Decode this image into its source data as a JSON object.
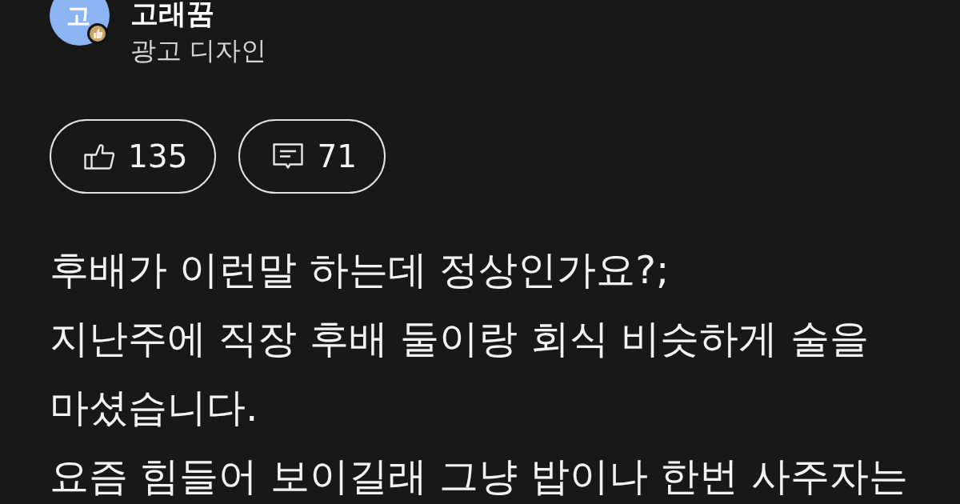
{
  "author": {
    "avatar_initial": "고",
    "name": "고래꿈",
    "job": "광고 디자인"
  },
  "reactions": [
    {
      "kind": "like",
      "count": "135"
    },
    {
      "kind": "comment",
      "count": "71"
    }
  ],
  "post": {
    "title": "후배가 이런말 하는데 정상인가요?;",
    "body_lines": [
      "지난주에 직장 후배 둘이랑 회식 비슷하게 술을",
      "마셨습니다.",
      "요즘 힘들어 보이길래 그냥 밥이나 한번 사주자는"
    ]
  }
}
